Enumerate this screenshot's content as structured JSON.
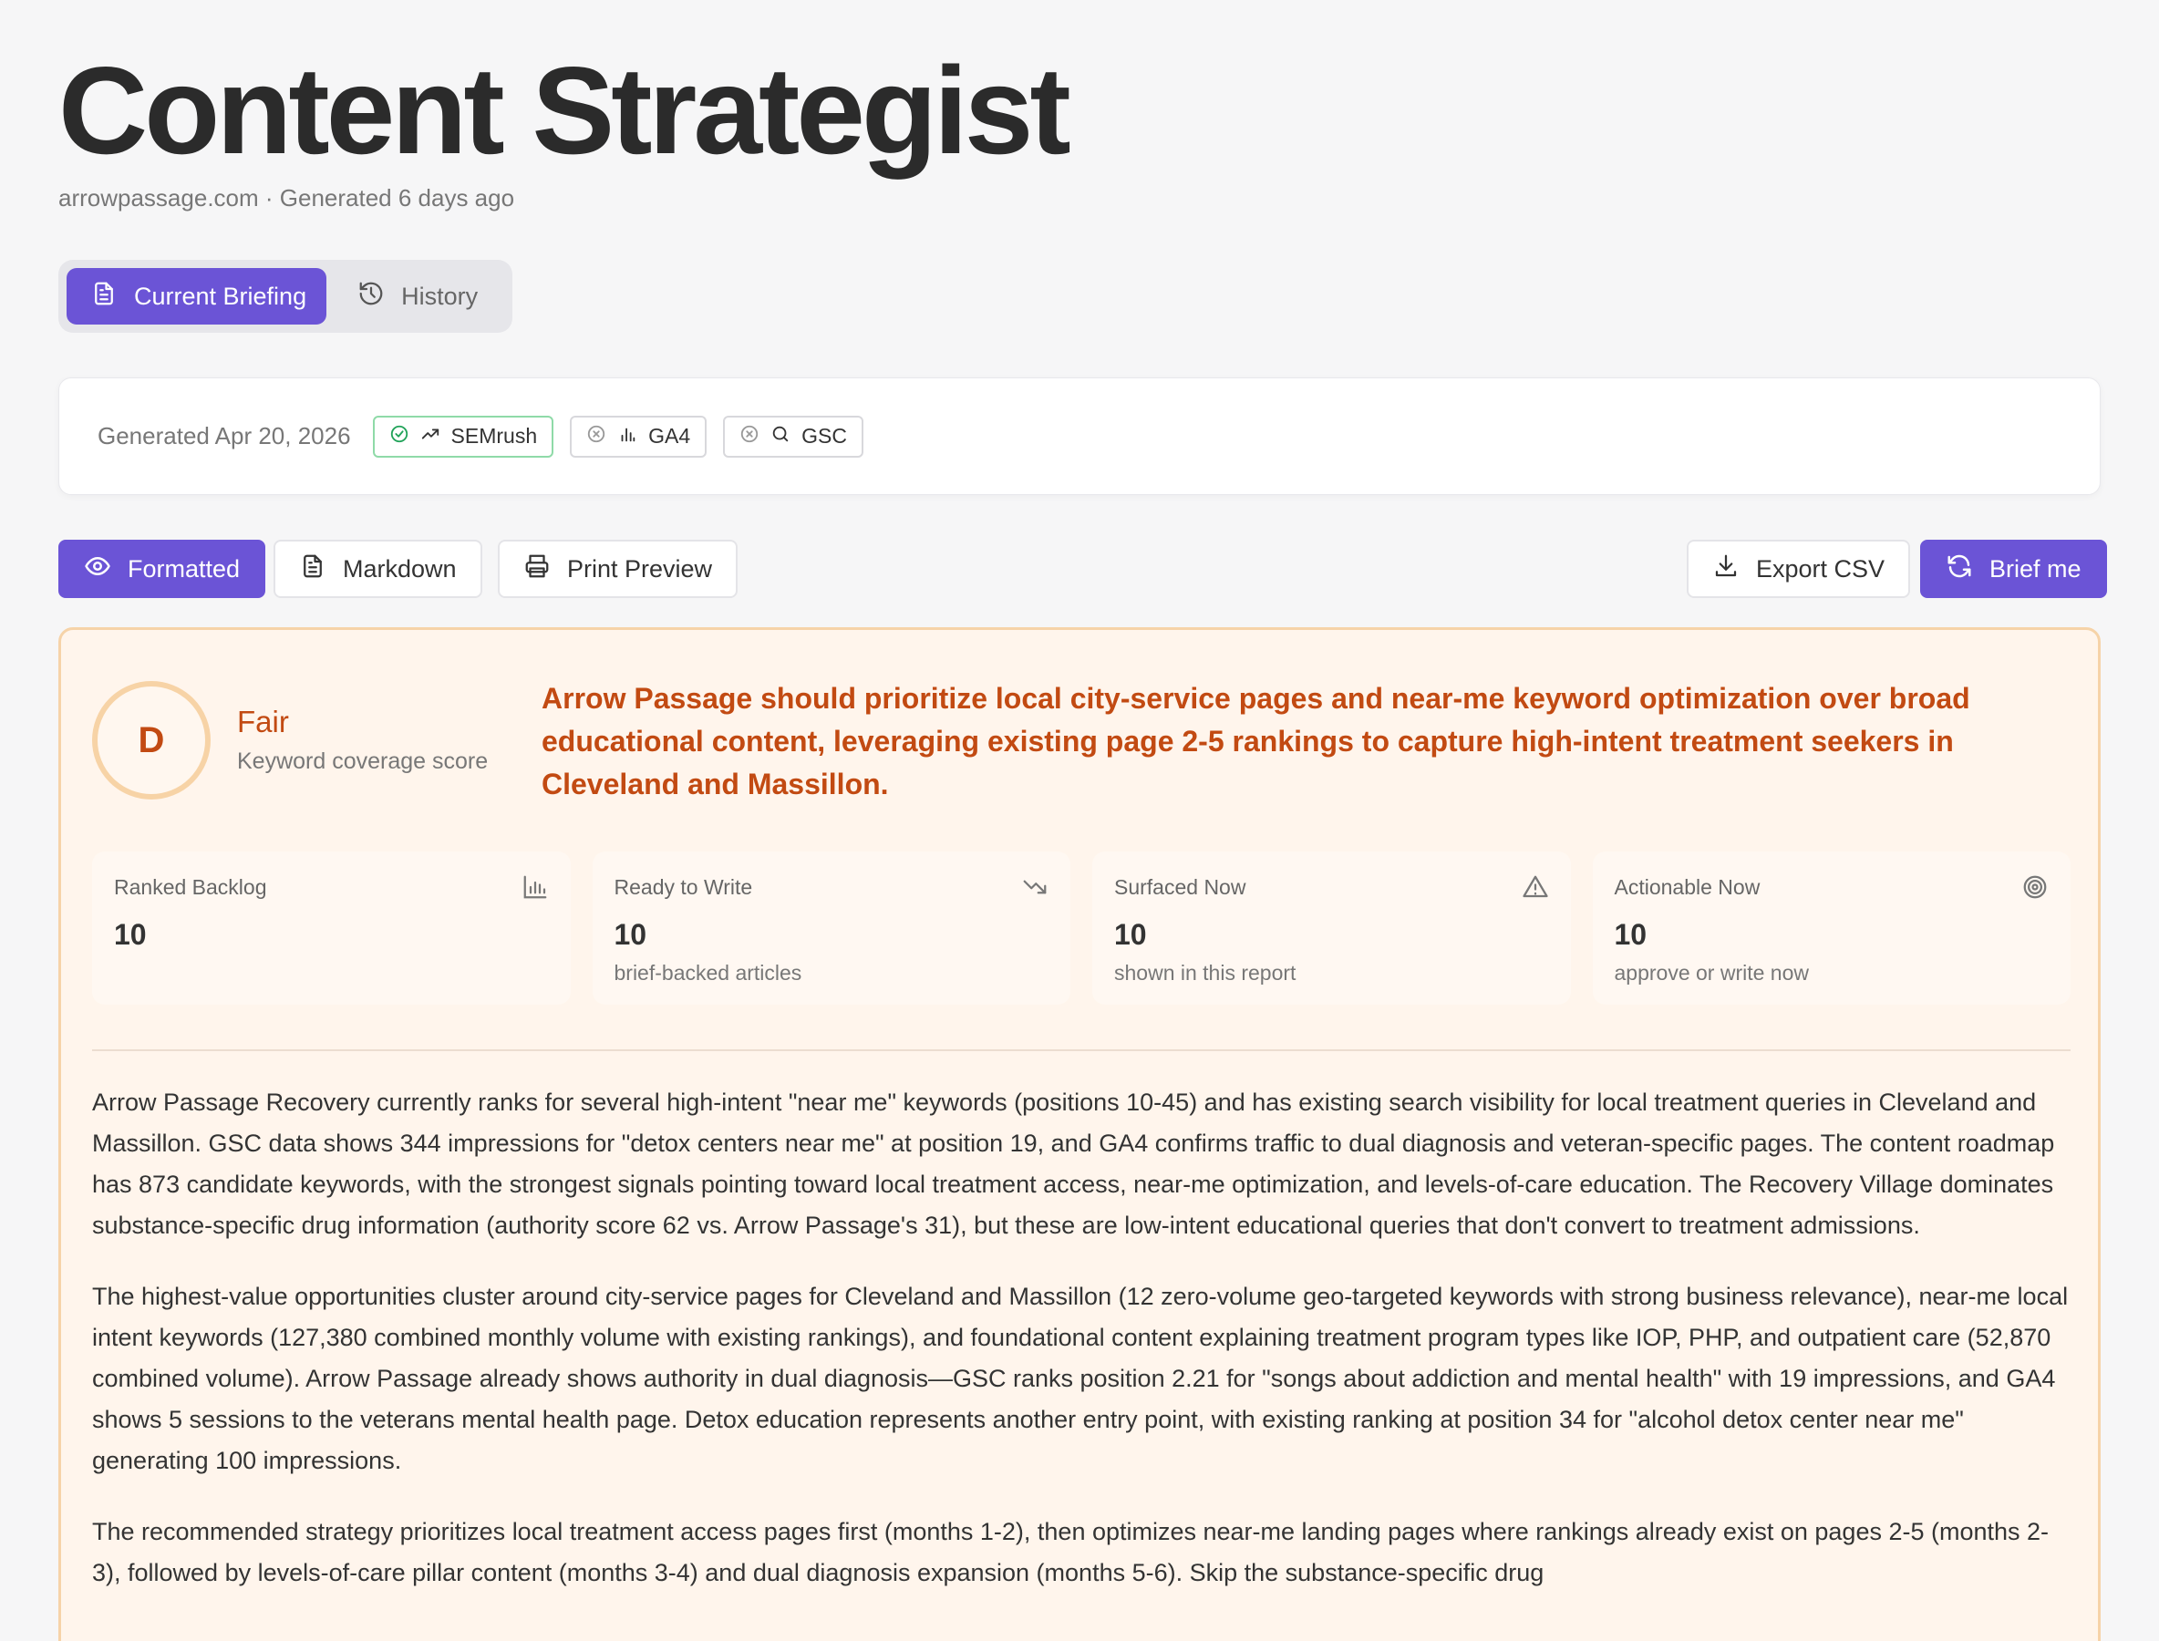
{
  "header": {
    "title": "Content Strategist",
    "subtitle": "arrowpassage.com · Generated 6 days ago"
  },
  "tabs": [
    {
      "label": "Current Briefing",
      "icon": "document-icon",
      "active": true
    },
    {
      "label": "History",
      "icon": "history-icon",
      "active": false
    }
  ],
  "sources": {
    "generated": "Generated Apr 20, 2026",
    "chips": [
      {
        "label": "SEMrush",
        "status": "connected",
        "icon": "trending-up-icon"
      },
      {
        "label": "GA4",
        "status": "unavailable",
        "icon": "bar-chart-icon"
      },
      {
        "label": "GSC",
        "status": "unavailable",
        "icon": "search-icon"
      }
    ]
  },
  "toolbar": {
    "formatted": "Formatted",
    "markdown": "Markdown",
    "print_preview": "Print Preview",
    "export_csv": "Export CSV",
    "brief_me": "Brief me"
  },
  "briefing": {
    "grade": "D",
    "grade_label": "Fair",
    "grade_sub": "Keyword coverage score",
    "headline": "Arrow Passage should prioritize local city-service pages and near-me keyword optimization over broad educational content, leveraging existing page 2-5 rankings to capture high-intent treatment seekers in Cleveland and Massillon.",
    "stats": [
      {
        "label": "Ranked Backlog",
        "value": "10",
        "sub": "",
        "icon": "bar-chart-icon"
      },
      {
        "label": "Ready to Write",
        "value": "10",
        "sub": "brief-backed articles",
        "icon": "trending-down-icon"
      },
      {
        "label": "Surfaced Now",
        "value": "10",
        "sub": "shown in this report",
        "icon": "warning-icon"
      },
      {
        "label": "Actionable Now",
        "value": "10",
        "sub": "approve or write now",
        "icon": "target-icon"
      }
    ],
    "paragraphs": [
      "Arrow Passage Recovery currently ranks for several high-intent \"near me\" keywords (positions 10-45) and has existing search visibility for local treatment queries in Cleveland and Massillon. GSC data shows 344 impressions for \"detox centers near me\" at position 19, and GA4 confirms traffic to dual diagnosis and veteran-specific pages. The content roadmap has 873 candidate keywords, with the strongest signals pointing toward local treatment access, near-me optimization, and levels-of-care education. The Recovery Village dominates substance-specific drug information (authority score 62 vs. Arrow Passage's 31), but these are low-intent educational queries that don't convert to treatment admissions.",
      "The highest-value opportunities cluster around city-service pages for Cleveland and Massillon (12 zero-volume geo-targeted keywords with strong business relevance), near-me local intent keywords (127,380 combined monthly volume with existing rankings), and foundational content explaining treatment program types like IOP, PHP, and outpatient care (52,870 combined volume). Arrow Passage already shows authority in dual diagnosis—GSC ranks position 2.21 for \"songs about addiction and mental health\" with 19 impressions, and GA4 shows 5 sessions to the veterans mental health page. Detox education represents another entry point, with existing ranking at position 34 for \"alcohol detox center near me\" generating 100 impressions.",
      "The recommended strategy prioritizes local treatment access pages first (months 1-2), then optimizes near-me landing pages where rankings already exist on pages 2-5 (months 2-3), followed by levels-of-care pillar content (months 3-4) and dual diagnosis expansion (months 5-6). Skip the substance-specific drug"
    ]
  }
}
